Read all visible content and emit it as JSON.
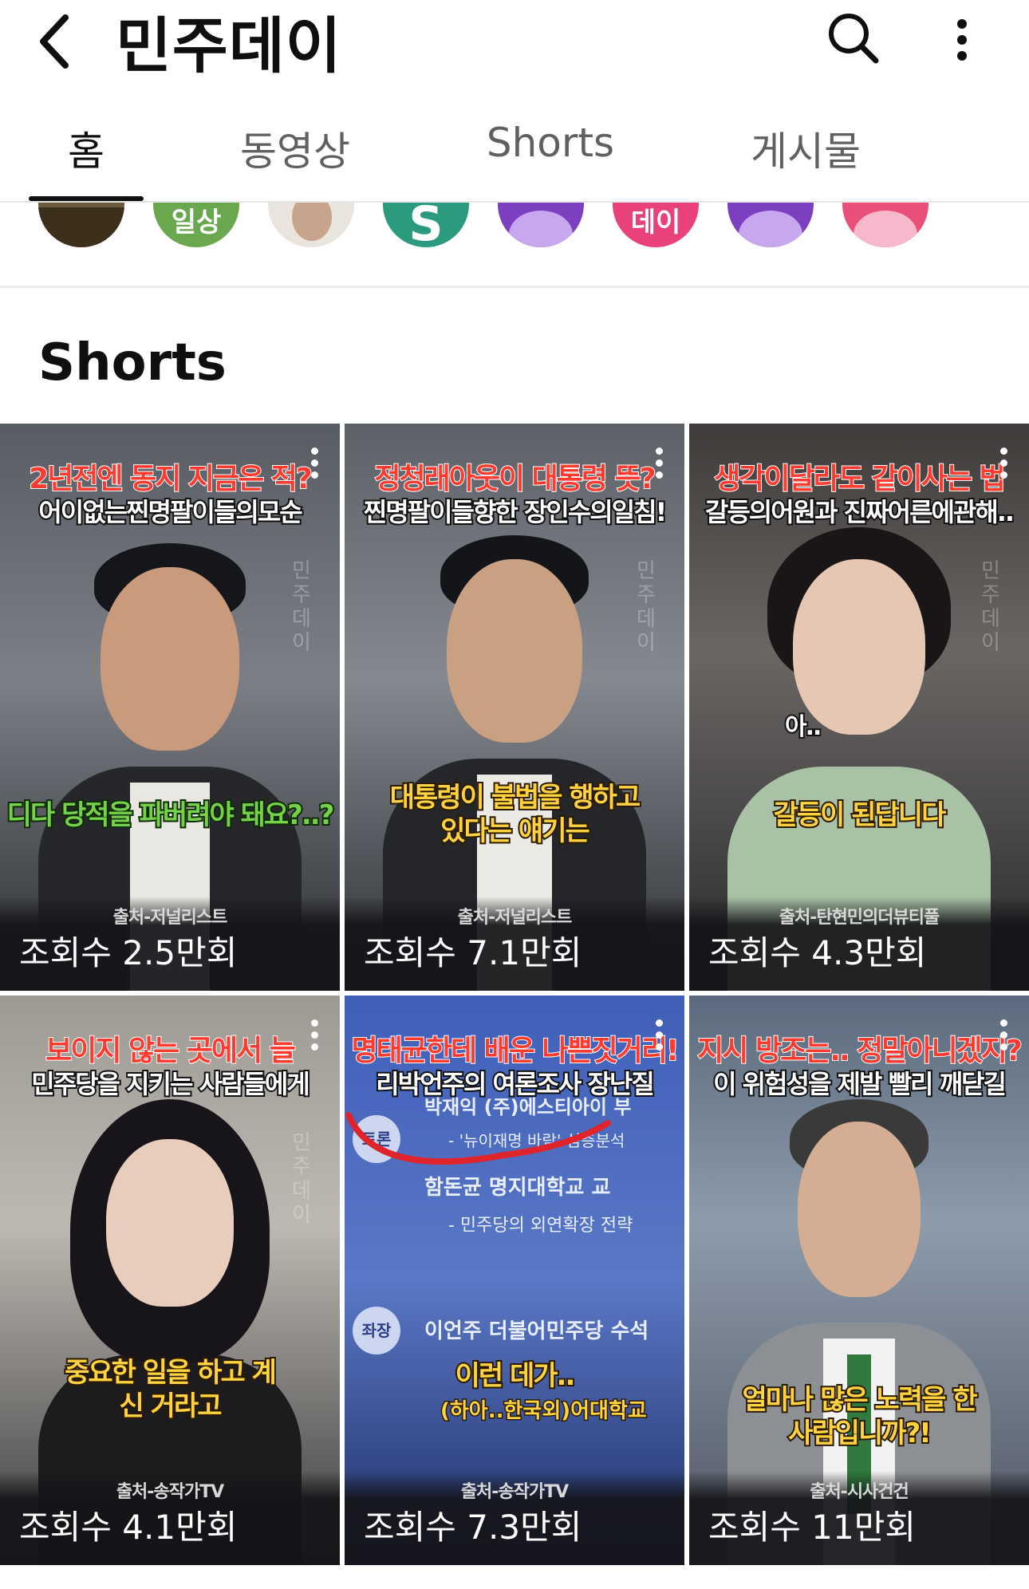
{
  "header": {
    "back_icon": "back-arrow-icon",
    "title": "민주데이",
    "search_icon": "search-icon",
    "more_icon": "more-vertical-icon"
  },
  "tabs": [
    {
      "label": "홈",
      "active": true
    },
    {
      "label": "동영상",
      "active": false
    },
    {
      "label": "Shorts",
      "active": false
    },
    {
      "label": "게시물",
      "active": false
    }
  ],
  "avatars": [
    {
      "color": "#6b5a3c",
      "label": ""
    },
    {
      "color": "#6aa84f",
      "label": "일상"
    },
    {
      "color": "#e9e4de",
      "label": ""
    },
    {
      "color": "#2b9a7e",
      "label": "S"
    },
    {
      "color": "#7b3fbf",
      "label": ""
    },
    {
      "color": "#e8417b",
      "label": "데이"
    },
    {
      "color": "#7b3fbf",
      "label": ""
    },
    {
      "color": "#ea4f7a",
      "label": ""
    }
  ],
  "section": {
    "title": "Shorts"
  },
  "shorts": [
    {
      "caption_top": "2년전엔 동지 지금은 적?",
      "caption_bottom": "어이없는찐명팔이들의모순",
      "subtitle": "디다 당적을 파버려야 돼요?..?",
      "source": "출처-저널리스트",
      "views": "조회수 2.5만회"
    },
    {
      "caption_top": "정청래아웃이 대통령 뜻?",
      "caption_bottom": "찐명팔이들향한 장인수의일침!",
      "subtitle": "대통령이 불법을 행하고 있다는 얘기는",
      "source": "출처-저널리스트",
      "views": "조회수 7.1만회"
    },
    {
      "caption_top": "생각이달라도 같이사는 법",
      "caption_bottom": "갈등의어원과 진짜어른에관해..",
      "subtitle": "갈등이 된답니다",
      "extra": "아..",
      "source": "출처-탄현민의더뷰티풀",
      "views": "조회수 4.3만회"
    },
    {
      "caption_top": "보이지 않는 곳에서 늘",
      "caption_bottom": "민주당을 지키는 사람들에게",
      "subtitle": "중요한 일을 하고 계신 거라고",
      "source": "출처-송작가TV",
      "views": "조회수 4.1만회"
    },
    {
      "caption_top": "명태균한테 배운 나쁜짓거리!",
      "caption_bottom": "리박언주의 여론조사 장난질",
      "subtitle": "이런 데가..",
      "doc_lines": [
        "박재익 (주)에스티아이 부",
        "- '뉴이재명 바람' 심층분석",
        "함돈균 명지대학교 교",
        "- 민주당의 외연확장 전략",
        "이언주 더불어민주당 수석",
        "(하아..한국외)어대학교"
      ],
      "doc_badges": [
        "토론",
        "좌장"
      ],
      "source": "출처-송작가TV",
      "views": "조회수 7.3만회"
    },
    {
      "caption_top": "지시 방조는.. 정말아니겠지?",
      "caption_bottom": "이 위험성을 제발 빨리 깨닫길",
      "subtitle": "얼마나 많은 노력을 한 사람입니까?!",
      "source": "출처-시사건건",
      "views": "조회수 11만회"
    }
  ],
  "watermark": "민주데이"
}
